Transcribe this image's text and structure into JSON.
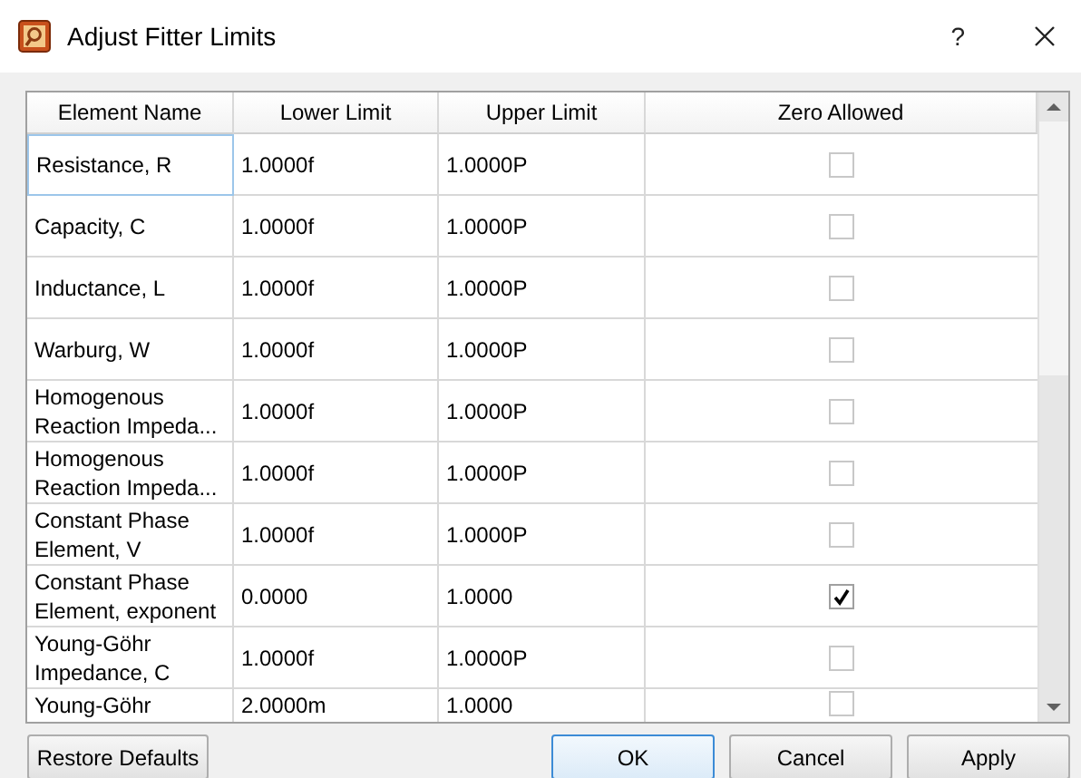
{
  "window": {
    "title": "Adjust Fitter Limits",
    "help": "?"
  },
  "table": {
    "columns": [
      "Element Name",
      "Lower Limit",
      "Upper Limit",
      "Zero Allowed"
    ],
    "rows": [
      {
        "name": "Resistance, R",
        "lower": "1.0000f",
        "upper": "1.0000P",
        "zero_allowed": false,
        "focused": true
      },
      {
        "name": "Capacity, C",
        "lower": "1.0000f",
        "upper": "1.0000P",
        "zero_allowed": false,
        "focused": false
      },
      {
        "name": "Inductance, L",
        "lower": "1.0000f",
        "upper": "1.0000P",
        "zero_allowed": false,
        "focused": false
      },
      {
        "name": "Warburg, W",
        "lower": "1.0000f",
        "upper": "1.0000P",
        "zero_allowed": false,
        "focused": false
      },
      {
        "name": "Homogenous Reaction Impeda...",
        "lower": "1.0000f",
        "upper": "1.0000P",
        "zero_allowed": false,
        "focused": false
      },
      {
        "name": "Homogenous Reaction Impeda...",
        "lower": "1.0000f",
        "upper": "1.0000P",
        "zero_allowed": false,
        "focused": false
      },
      {
        "name": "Constant Phase Element, V",
        "lower": "1.0000f",
        "upper": "1.0000P",
        "zero_allowed": false,
        "focused": false
      },
      {
        "name": "Constant Phase Element, exponent",
        "lower": "0.0000",
        "upper": "1.0000",
        "zero_allowed": true,
        "focused": false
      },
      {
        "name": "Young-Göhr Impedance, C",
        "lower": "1.0000f",
        "upper": "1.0000P",
        "zero_allowed": false,
        "focused": false
      },
      {
        "name": "Young-Göhr",
        "lower": "2.0000m",
        "upper": "1.0000",
        "zero_allowed": false,
        "focused": false
      }
    ]
  },
  "buttons": [
    {
      "label": "Restore Defaults",
      "kind": "left",
      "default": false
    },
    {
      "label": "OK",
      "kind": "right",
      "default": true
    },
    {
      "label": "Cancel",
      "kind": "right",
      "default": false
    },
    {
      "label": "Apply",
      "kind": "right",
      "default": false
    }
  ]
}
